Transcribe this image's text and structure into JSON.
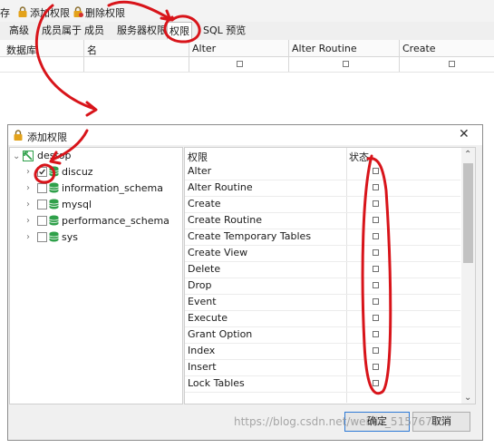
{
  "toolbar": {
    "partial_label": "存",
    "add_label": "添加权限",
    "delete_label": "删除权限"
  },
  "tabs": [
    "高级",
    "成员属于",
    "成员",
    "服务器权限",
    "权限",
    "SQL 预览"
  ],
  "grid": {
    "headers": [
      "数据库",
      "名",
      "Alter",
      "Alter Routine",
      "Create"
    ]
  },
  "dialog": {
    "title": "添加权限",
    "tree": {
      "root": "destop",
      "items": [
        {
          "label": "discuz",
          "checked": true
        },
        {
          "label": "information_schema",
          "checked": false
        },
        {
          "label": "mysql",
          "checked": false
        },
        {
          "label": "performance_schema",
          "checked": false
        },
        {
          "label": "sys",
          "checked": false
        }
      ]
    },
    "priv_header": {
      "name": "权限",
      "status": "状态"
    },
    "privileges": [
      "Alter",
      "Alter Routine",
      "Create",
      "Create Routine",
      "Create Temporary Tables",
      "Create View",
      "Delete",
      "Drop",
      "Event",
      "Execute",
      "Grant Option",
      "Index",
      "Insert",
      "Lock Tables"
    ],
    "ok_label": "确定",
    "cancel_label": "取消"
  },
  "watermark": "https://blog.csdn.net/weixin_51576723",
  "colors": {
    "annotation": "#d8141a",
    "accent": "#2e7ad6",
    "db_icon": "#2fa04a"
  }
}
